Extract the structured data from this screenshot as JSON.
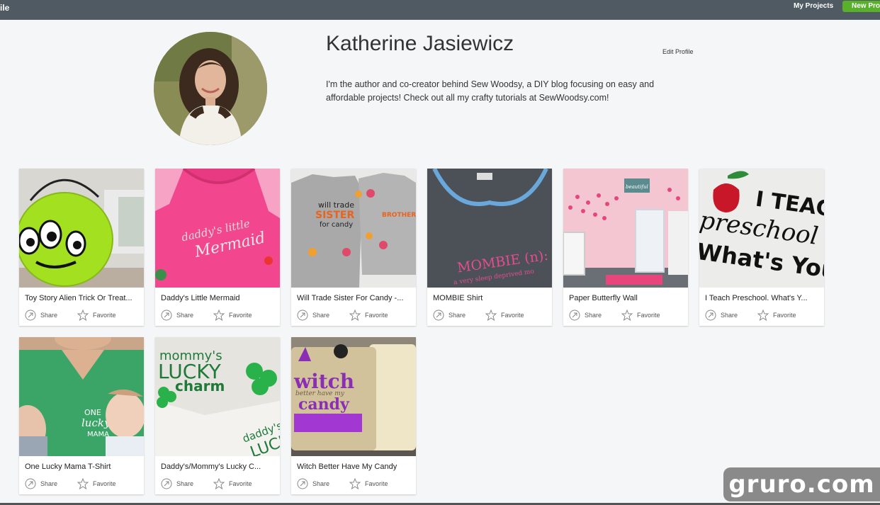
{
  "header": {
    "left_title": "ile",
    "my_projects": "My Projects",
    "new_project": "New Pro"
  },
  "profile": {
    "name": "Katherine Jasiewicz",
    "edit_label": "Edit Profile",
    "bio_line1": "I'm the author and co-creator behind Sew Woodsy, a DIY blog focusing on easy and",
    "bio_line2": "affordable projects! Check out all my crafty tutorials at SewWoodsy.com!"
  },
  "card_actions": {
    "share": "Share",
    "favorite": "Favorite"
  },
  "projects": [
    {
      "title": "Toy Story Alien Trick Or Treat..."
    },
    {
      "title": "Daddy's Little Mermaid",
      "image_text_1": "daddy's little",
      "image_text_2": "Mermaid"
    },
    {
      "title": "Will Trade Sister For Candy -...",
      "image_text_1": "will trade",
      "image_text_2": "SISTER",
      "image_text_3": "for candy",
      "image_text_4": "BROTHER"
    },
    {
      "title": "MOMBIE Shirt",
      "image_text_1": "MOMBIE (n):",
      "image_text_2": "a very sleep deprived mo"
    },
    {
      "title": "Paper Butterfly Wall",
      "image_text_1": "beautiful"
    },
    {
      "title": "I Teach Preschool. What's Y...",
      "image_text_1": "I TEACH",
      "image_text_2": "preschool",
      "image_text_3": "What's Your"
    },
    {
      "title": "One Lucky Mama T-Shirt",
      "image_text_1": "ONE",
      "image_text_2": "lucky",
      "image_text_3": "MAMA"
    },
    {
      "title": "Daddy's/Mommy's Lucky C...",
      "image_text_1": "mommy's",
      "image_text_2": "LUCKY",
      "image_text_3": "charm",
      "image_text_4": "daddy's",
      "image_text_5": "LUCK"
    },
    {
      "title": "Witch Better Have My Candy",
      "image_text_1": "witch",
      "image_text_2": "better have my",
      "image_text_3": "candy"
    }
  ],
  "watermark": "gruro.com",
  "colors": {
    "topbar": "#4f5a62",
    "new_project": "#58b02b",
    "background": "#f5f6f7"
  }
}
